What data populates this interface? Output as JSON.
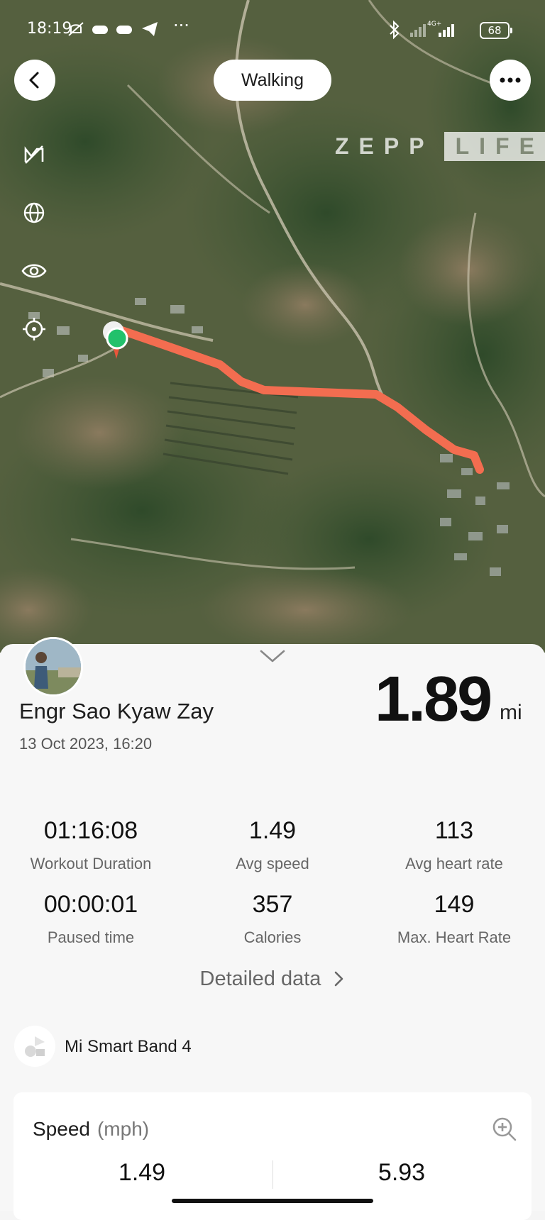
{
  "status_bar": {
    "time": "18:19",
    "battery": "68",
    "network": "4G+",
    "icons": [
      "mute-bell-icon",
      "game-icon",
      "game-icon",
      "telegram-icon",
      "more-dots-icon",
      "bluetooth-icon",
      "signal-icon"
    ]
  },
  "header": {
    "title": "Walking"
  },
  "watermark": {
    "part1": "ZEPP",
    "part2": "LIFE"
  },
  "map_tools": [
    "satellite-toggle-icon",
    "globe-icon",
    "eye-icon",
    "locate-icon"
  ],
  "colors": {
    "route": "#f36d50",
    "start_marker": "#22c16b",
    "accent_bg": "#f7f7f7"
  },
  "workout": {
    "user_name": "Engr Sao Kyaw Zay",
    "date": "13 Oct 2023, 16:20",
    "distance": "1.89",
    "distance_unit": "mi"
  },
  "stats": [
    {
      "value": "01:16:08",
      "label": "Workout Duration"
    },
    {
      "value": "1.49",
      "label": "Avg speed"
    },
    {
      "value": "113",
      "label": "Avg heart rate"
    },
    {
      "value": "00:00:01",
      "label": "Paused time"
    },
    {
      "value": "357",
      "label": "Calories"
    },
    {
      "value": "149",
      "label": "Max. Heart Rate"
    }
  ],
  "detailed_data_label": "Detailed data",
  "device": {
    "name": "Mi Smart Band 4"
  },
  "speed_card": {
    "title": "Speed",
    "unit": "(mph)",
    "values": [
      "1.49",
      "5.93"
    ]
  }
}
